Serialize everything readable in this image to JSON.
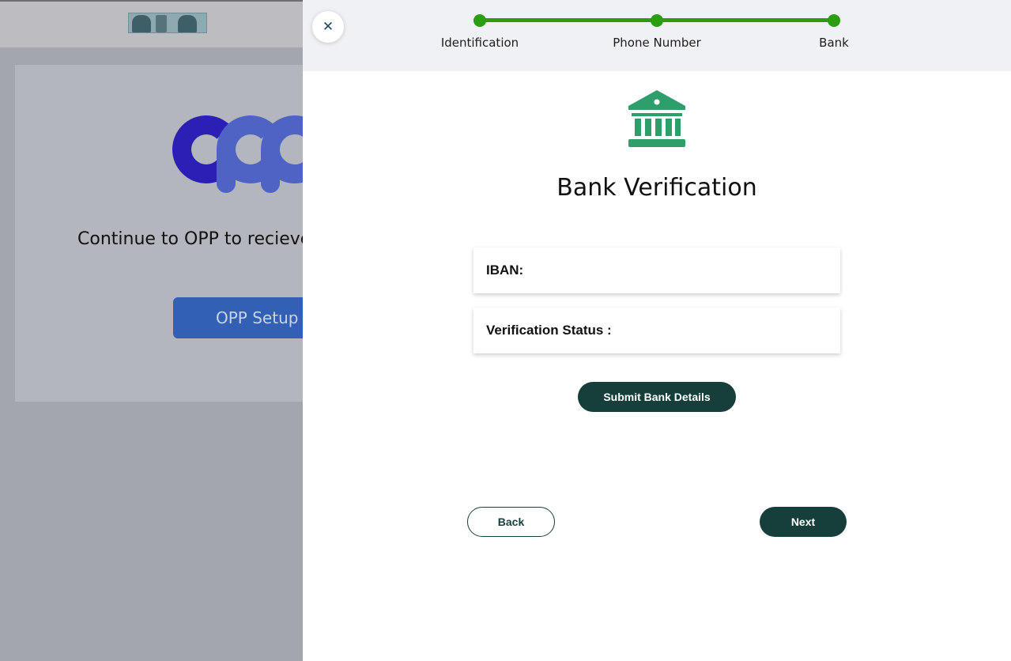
{
  "background": {
    "continue_text": "Continue to OPP to recieve",
    "setup_button_label": "OPP Setup"
  },
  "drawer": {
    "close_icon": "close-icon",
    "steps": [
      {
        "label": "Identification",
        "completed": true
      },
      {
        "label": "Phone Number",
        "completed": true
      },
      {
        "label": "Bank",
        "completed": true
      }
    ],
    "step_color": "#2a9d11",
    "icon": "bank-icon",
    "icon_color": "#2e9e6b",
    "title": "Bank Verification",
    "fields": {
      "iban_label": "IBAN:",
      "iban_value": "",
      "status_label": "Verification Status :",
      "status_value": ""
    },
    "submit_label": "Submit Bank Details",
    "back_label": "Back",
    "next_label": "Next",
    "accent_color": "#163f3c"
  }
}
